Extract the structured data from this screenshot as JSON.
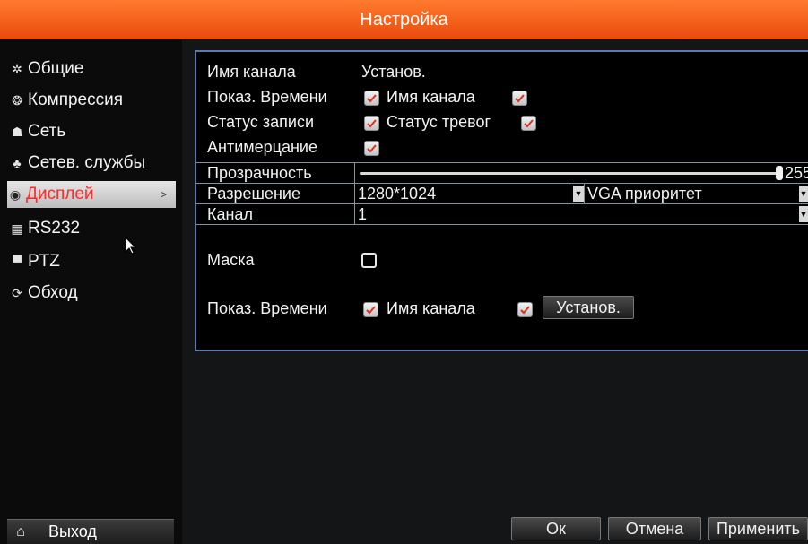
{
  "window": {
    "title": "Настройка"
  },
  "sidebar": {
    "items": [
      {
        "label": "Общие",
        "icon": "gear-icon"
      },
      {
        "label": "Компрессия",
        "icon": "compression-icon"
      },
      {
        "label": "Сеть",
        "icon": "network-icon"
      },
      {
        "label": "Сетев. службы",
        "icon": "network-services-icon"
      },
      {
        "label": "Дисплей",
        "icon": "eye-icon",
        "active": true
      },
      {
        "label": "RS232",
        "icon": "serial-port-icon"
      },
      {
        "label": "PTZ",
        "icon": "camera-icon"
      },
      {
        "label": "Обход",
        "icon": "patrol-icon"
      }
    ],
    "exit_label": "Выход"
  },
  "osd": {
    "channel_name_label": "Имя канала",
    "set_label": "Установ.",
    "show_time_label": "Показ. Времени",
    "show_time_checked": true,
    "channel_name_label2": "Имя канала",
    "channel_name_checked": true,
    "record_status_label": "Статус записи",
    "record_status_checked": true,
    "alarm_status_label": "Статус тревог",
    "alarm_status_checked": true,
    "antiflicker_label": "Антимерцание",
    "antiflicker_checked": true
  },
  "transparency": {
    "label": "Прозрачность",
    "value": "255"
  },
  "resolution": {
    "label": "Разрешение",
    "value": "1280*1024",
    "priority": "VGA приоритет"
  },
  "channel": {
    "label": "Канал",
    "value": "1"
  },
  "mask": {
    "label": "Маска",
    "checked": false
  },
  "channel_osd": {
    "show_time_label": "Показ. Времени",
    "show_time_checked": true,
    "channel_name_label": "Имя канала",
    "channel_name_checked": true,
    "set_button": "Установ."
  },
  "footer": {
    "ok": "Ок",
    "cancel": "Отмена",
    "apply": "Применить"
  },
  "colors": {
    "title_bar": "#f05a1a",
    "active_item_text": "#ff2a2a",
    "panel_border": "#5a7aa8"
  }
}
